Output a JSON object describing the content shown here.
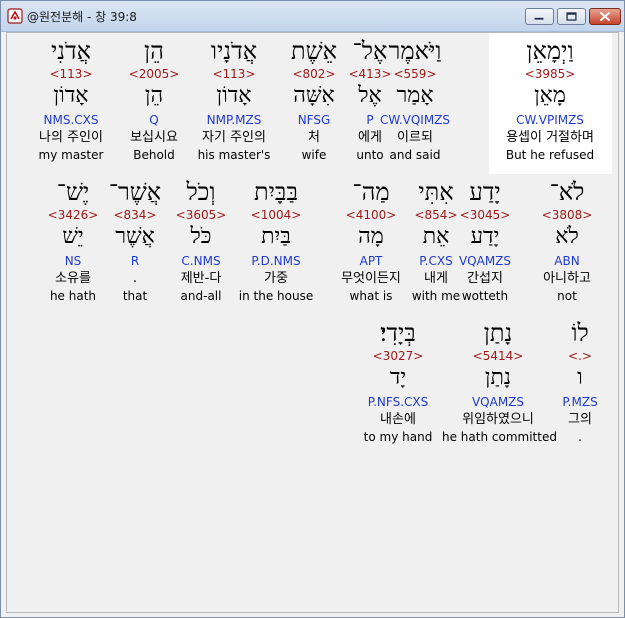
{
  "window": {
    "title": "@원전분해 - 창 39:8"
  },
  "rows": [
    {
      "words": [
        {
          "heb": "וַיְמָאֵן",
          "strong": "<3985>",
          "lemma": "מָאֵן",
          "morph": "CW.VPIMZS",
          "kor": "용셉이 거절하며",
          "eng": "But he refused",
          "selected": true
        },
        {
          "heb": "וַיֹּאמֶר",
          "strong": "<559>",
          "lemma": "אָמַר",
          "morph": "CW.VQIMZS",
          "kor": "이르되",
          "eng": "and said"
        },
        {
          "heb": "אֶל־",
          "strong": "<413>",
          "lemma": "אֶל",
          "morph": "P",
          "kor": "에게",
          "eng": "unto"
        },
        {
          "heb": "אֵשֶׁת",
          "strong": "<802>",
          "lemma": "אִשָּׁה",
          "morph": "NFSG",
          "kor": "처",
          "eng": "wife"
        },
        {
          "heb": "אֲדֹנָיו",
          "strong": "<113>",
          "lemma": "אָדוֹן",
          "morph": "NMP.MZS",
          "kor": "자기 주인의",
          "eng": "his master's"
        },
        {
          "heb": "הֵן",
          "strong": "<2005>",
          "lemma": "הֵן",
          "morph": "Q",
          "kor": "보십시요",
          "eng": "Behold"
        },
        {
          "heb": "אֲדֹנִי",
          "strong": "<113>",
          "lemma": "אָדוֹן",
          "morph": "NMS.CXS",
          "kor": "나의 주인이",
          "eng": "my master"
        }
      ]
    },
    {
      "words": [
        {
          "heb": "לֹא־",
          "strong": "<3808>",
          "lemma": "לֹא",
          "morph": "ABN",
          "kor": "아니하고",
          "eng": "not"
        },
        {
          "heb": "יָדַע",
          "strong": "<3045>",
          "lemma": "יָדַע",
          "morph": "VQAMZS",
          "kor": "간섭지",
          "eng": "wotteth"
        },
        {
          "heb": "אִתִּי",
          "strong": "<854>",
          "lemma": "אֵת",
          "morph": "P.CXS",
          "kor": "내게",
          "eng": "with me"
        },
        {
          "heb": "מַה־",
          "strong": "<4100>",
          "lemma": "מָה",
          "morph": "APT",
          "kor": "무엇이든지",
          "eng": "what is"
        },
        {
          "heb": "בַּבָּיִת",
          "strong": "<1004>",
          "lemma": "בַּיִת",
          "morph": "P.D.NMS",
          "kor": "가중",
          "eng": "in the house"
        },
        {
          "heb": "וְכֹל",
          "strong": "<3605>",
          "lemma": "כֹּל",
          "morph": "C.NMS",
          "kor": "제반-다",
          "eng": "and-all"
        },
        {
          "heb": "אֲשֶׁר־",
          "strong": "<834>",
          "lemma": "אֲשֶׁר",
          "morph": "R",
          "kor": ".",
          "eng": "that"
        },
        {
          "heb": "יֶשׁ־",
          "strong": "<3426>",
          "lemma": "יֵשׁ",
          "morph": "NS",
          "kor": "소유를",
          "eng": "he hath"
        }
      ]
    },
    {
      "words": [
        {
          "heb": "לוֹ",
          "strong": "<.>",
          "lemma": "ו",
          "morph": "P.MZS",
          "kor": "그의",
          "eng": "."
        },
        {
          "heb": "נָתַן",
          "strong": "<5414>",
          "lemma": "נָתַן",
          "morph": "VQAMZS",
          "kor": "위임하였으니",
          "eng": "he hath committed"
        },
        {
          "heb": "בְּיָדִי׃",
          "strong": "<3027>",
          "lemma": "יָד",
          "morph": "P.NFS.CXS",
          "kor": "내손에",
          "eng": "to my hand"
        }
      ]
    }
  ]
}
